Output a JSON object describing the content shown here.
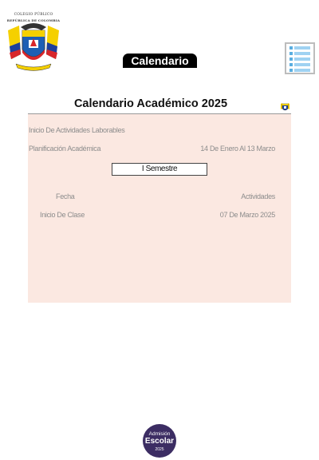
{
  "header": {
    "crest_line1": "COLEGIO PÚBLICO",
    "crest_line2": "REPÚBLICA DE COLOMBIA",
    "title": "Calendario",
    "menu_icon": "list-menu-icon"
  },
  "calendar": {
    "title": "Calendario Académico 2025",
    "rows": [
      {
        "label": "Inicio De Actividades Laborables",
        "value": ""
      },
      {
        "label": "Planificación Académica",
        "value": "14 De Enero Al 13 Marzo"
      }
    ],
    "semester_label": "I Semestre",
    "table": {
      "col_date": "Fecha",
      "col_activity": "Actividades",
      "rows": [
        {
          "activity": "Inicio De Clase",
          "date": "07 De Marzo 2025"
        }
      ]
    }
  },
  "footer": {
    "badge_line1": "Admisión",
    "badge_line2": "Escolar",
    "badge_line3": "2025"
  },
  "colors": {
    "card_bg": "#fbe8e1",
    "badge_bg": "#3c2d63",
    "menu_accent": "#5aaee0"
  }
}
